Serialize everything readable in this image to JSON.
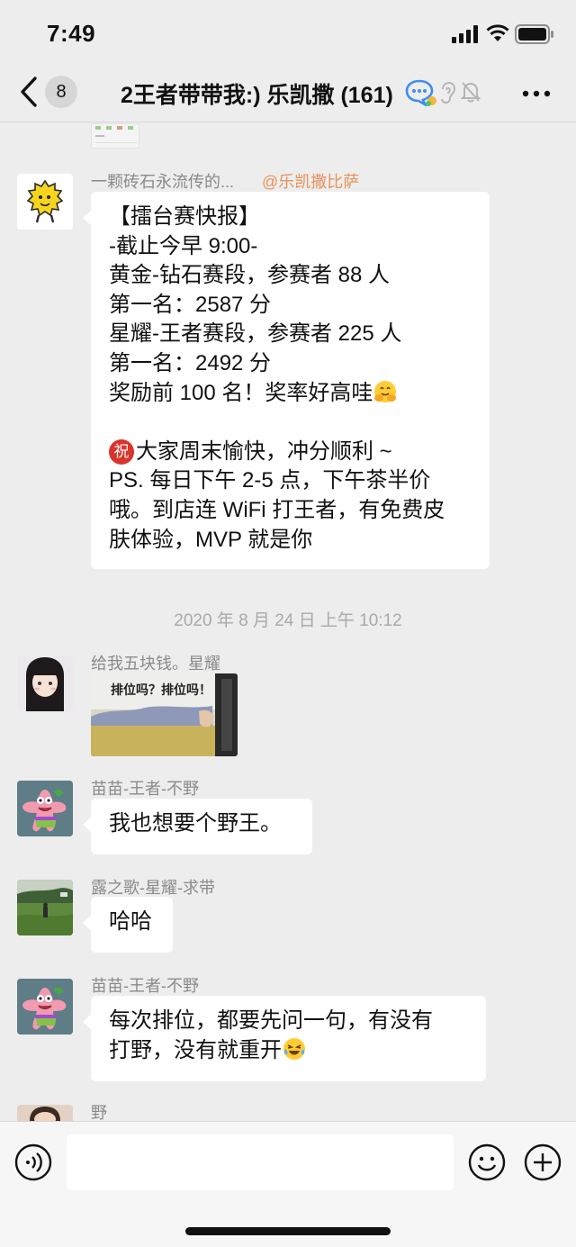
{
  "status_bar": {
    "time": "7:49"
  },
  "header": {
    "unread_count": "8",
    "title": "2王者带带我:) 乐凯撒 (161)"
  },
  "messages": [
    {
      "sender": "一颗砖石永流传的...",
      "mention": "@乐凯撒比萨",
      "lines": [
        "【擂台赛快报】",
        "-截止今早 9:00-",
        "黄金-钻石赛段，参赛者 88 人",
        "第一名：2587 分",
        "星耀-王者赛段，参赛者 225 人",
        "第一名：2492 分",
        "奖励前 100 名！奖率好高哇",
        "",
        "大家周末愉快，冲分顺利 ~",
        "PS. 每日下午 2-5 点，下午茶半价",
        "哦。到店连 WiFi 打王者，有免费皮",
        "肤体验，MVP 就是你"
      ],
      "zhu_badge": "祝"
    },
    {
      "timestamp": "2020 年 8 月 24 日 上午 10:12"
    },
    {
      "sender": "给我五块钱。星耀",
      "image_caption": "排位吗？排位吗！"
    },
    {
      "sender": "苗苗-王者-不野",
      "text": "我也想要个野王。"
    },
    {
      "sender": "露之歌-星耀-求带",
      "text": "哈哈"
    },
    {
      "sender": "苗苗-王者-不野",
      "lines": [
        "每次排位，都要先问一句，有没有",
        "打野，没有就重开"
      ]
    },
    {
      "sender": "野"
    }
  ],
  "colors": {
    "background": "#ededed",
    "bubble": "#ffffff",
    "mention": "#e8935a",
    "sender": "#8a8a8a",
    "zhu_badge": "#d9342b"
  },
  "icons": [
    "back-icon",
    "chat-bubble-icon",
    "ear-icon",
    "mute-icon",
    "more-icon",
    "voice-icon",
    "emoji-icon",
    "plus-icon"
  ]
}
